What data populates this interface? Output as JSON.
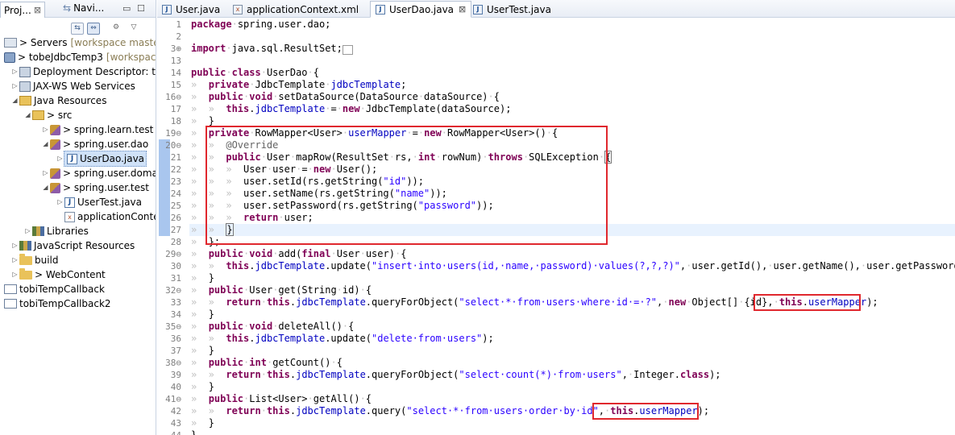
{
  "left_panel": {
    "tabs": [
      {
        "label": "Proj...",
        "close": "⊠",
        "active": true
      },
      {
        "label": "Navi...",
        "active": false
      }
    ],
    "view_controls": [
      "▭",
      "☐"
    ],
    "toolbar": [
      "⇆",
      "⇔",
      "⚙",
      "▽"
    ],
    "tree": [
      {
        "label": "> Servers",
        "extra": "[workspace master]",
        "icon": "server-icon"
      },
      {
        "label": "> tobeJdbcTemp3",
        "extra": "[workspace",
        "icon": "web-project-icon"
      },
      {
        "label": "Deployment Descriptor: to",
        "icon": "deployment-descriptor-icon"
      },
      {
        "label": "JAX-WS Web Services",
        "icon": "web-services-icon"
      },
      {
        "label": "Java Resources",
        "icon": "java-resources-icon"
      },
      {
        "label": "> src",
        "icon": "source-folder-icon"
      },
      {
        "label": "> spring.learn.test",
        "icon": "package-icon"
      },
      {
        "label": "> spring.user.dao",
        "icon": "package-icon"
      },
      {
        "label": "UserDao.java",
        "icon": "java-file-icon"
      },
      {
        "label": "> spring.user.doma",
        "icon": "package-icon"
      },
      {
        "label": "> spring.user.test",
        "icon": "package-icon"
      },
      {
        "label": "UserTest.java",
        "icon": "java-file-icon"
      },
      {
        "label": "applicationContext.",
        "icon": "xml-file-icon"
      },
      {
        "label": "Libraries",
        "icon": "libraries-icon"
      },
      {
        "label": "JavaScript Resources",
        "icon": "javascript-resources-icon"
      },
      {
        "label": "build",
        "icon": "folder-icon"
      },
      {
        "label": "> WebContent",
        "icon": "folder-icon"
      },
      {
        "label": "tobiTempCallback",
        "icon": "project-icon"
      },
      {
        "label": "tobiTempCallback2",
        "icon": "project-icon"
      }
    ]
  },
  "editor": {
    "tabs": [
      {
        "label": "User.java",
        "icon": "J"
      },
      {
        "label": "applicationContext.xml",
        "icon": "x"
      },
      {
        "label": "UserDao.java",
        "icon": "J",
        "active": true,
        "close": "⊠"
      },
      {
        "label": "UserTest.java",
        "icon": "J"
      }
    ],
    "line_numbers": [
      "1",
      "2",
      "3⊕",
      "13",
      "14",
      "15",
      "16⊖",
      "17",
      "18",
      "19⊖",
      "20⊖",
      "21",
      "22",
      "23",
      "24",
      "25",
      "26",
      "27",
      "28",
      "29⊖",
      "30",
      "31",
      "32⊖",
      "33",
      "34",
      "35⊖",
      "36",
      "37",
      "38⊖",
      "39",
      "40",
      "41⊖",
      "42",
      "43",
      "44"
    ]
  }
}
